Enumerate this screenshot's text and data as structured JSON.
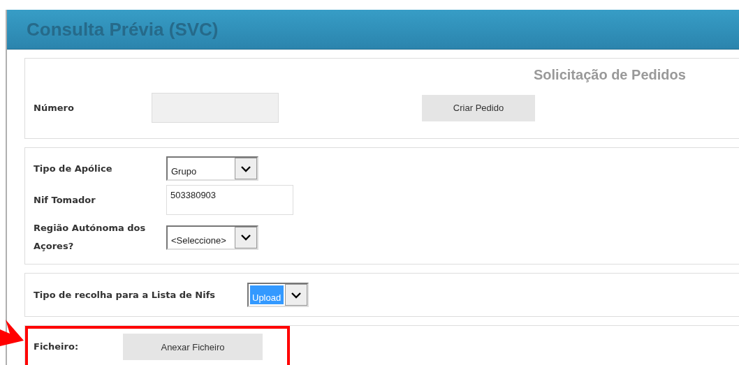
{
  "header": {
    "title": "Consulta Prévia (SVC)"
  },
  "request_panel": {
    "title": "Solicitação de Pedidos",
    "number_label": "Número",
    "create_button": "Criar Pedido"
  },
  "policy_panel": {
    "fields": [
      {
        "kind": "select",
        "label": "Tipo de Apólice",
        "value": "Grupo",
        "highlighted": false
      },
      {
        "kind": "input",
        "label": "Nif Tomador",
        "value": "503380903"
      },
      {
        "kind": "select",
        "label": "Região Autónoma dos Açores?",
        "value": "<Seleccione>",
        "highlighted": false
      }
    ]
  },
  "collection_panel": {
    "label": "Tipo de recolha para a Lista de Nifs",
    "select": {
      "value": "Upload",
      "highlighted": true
    }
  },
  "file_panel": {
    "label": "Ficheiro:",
    "attach_button": "Anexar Ficheiro",
    "annotated": true
  }
}
